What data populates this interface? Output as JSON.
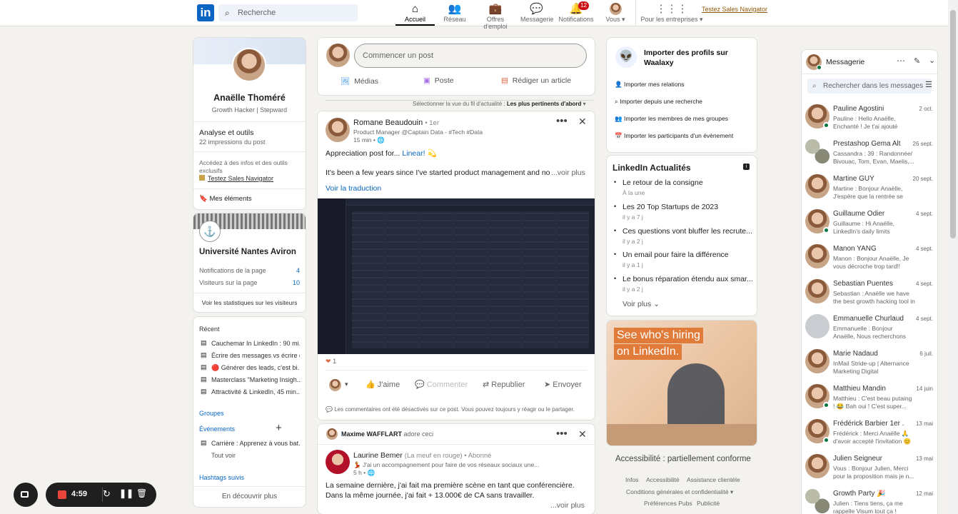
{
  "topbar": {
    "logo": "in",
    "search_placeholder": "Recherche",
    "nav": [
      {
        "label": "Accueil",
        "icon": "home-icon"
      },
      {
        "label": "Réseau",
        "icon": "network-icon"
      },
      {
        "label": "Offres d'emploi",
        "icon": "jobs-icon"
      },
      {
        "label": "Messagerie",
        "icon": "messaging-icon"
      },
      {
        "label": "Notifications",
        "icon": "bell-icon",
        "badge": "12"
      },
      {
        "label": "Vous ▾",
        "icon": "me-avatar"
      },
      {
        "label": "Pour les entreprises ▾",
        "icon": "grid-icon"
      }
    ],
    "sales_navigator": "Testez Sales Navigator"
  },
  "profile": {
    "name": "Anaëlle Thoméré",
    "headline": "Growth Hacker | Stepward",
    "analytics_title": "Analyse et outils",
    "analytics_sub": "22 impressions du post",
    "premium_text": "Accédez à des infos et des outils exclusifs",
    "premium_link": "Testez Sales Navigator",
    "saved": "Mes éléments"
  },
  "page_card": {
    "name": "Université Nantes Aviron",
    "notif_label": "Notifications de la page",
    "notif_value": "4",
    "visitors_label": "Visiteurs sur la page",
    "visitors_value": "10",
    "stats_link": "Voir les statistiques sur les visiteurs"
  },
  "recent": {
    "title": "Récent",
    "items": [
      "Cauchemar In LinkedIn : 90 mi...",
      "Écrire des messages vs écrire d...",
      "🔴 Générer des leads, c'est bi...",
      "Masterclass \"Marketing Insigh...",
      "Attractivité & LinkedIn, 45 min..."
    ],
    "groups": "Groupes",
    "events": "Événements",
    "event_item": "Carrière : Apprenez à vous bat...",
    "see_all": "Tout voir",
    "hashtags": "Hashtags suivis",
    "discover": "En découvrir plus"
  },
  "composer": {
    "placeholder": "Commencer un post",
    "media": "Médias",
    "post": "Poste",
    "article": "Rédiger un article"
  },
  "feed_sort": {
    "label": "Sélectionner la vue du fil d'actualité :",
    "value": "Les plus pertinents d'abord"
  },
  "post1": {
    "author": "Romane Beaudouin",
    "degree": "• 1er",
    "headline": "Product Manager @Captain Data - #Tech #Data",
    "time": "15 min • 🌐",
    "text1": "Appreciation post for...",
    "mention": "Linear!",
    "emoji": "💫",
    "text2": "It's been a few years since I've started product management and nobody",
    "see_more": "...voir plus",
    "translate": "Voir la traduction",
    "reactions": "1",
    "like": "J'aime",
    "comment": "Commenter",
    "repost": "Republier",
    "send": "Envoyer",
    "comments_off": "Les commentaires ont été désactivés sur ce post. Vous pouvez toujours y réagir ou le partager."
  },
  "post2": {
    "liker": "Maxime WAFFLART",
    "liker_action": "adore ceci",
    "author": "Laurine Bemer",
    "author_note": "(La meuf en rouge) • Abonné",
    "headline": "💃 J'ai un accompagnement pour faire de vos réseaux sociaux une...",
    "time": "5 h • 🌐",
    "line1": "La semaine dernière, j'ai fait ma première scène en tant que conférencière.",
    "line2": "Dans la même journée, j'ai fait + 13.000€ de CA sans travailler.",
    "see_more": "...voir plus"
  },
  "waalaxy": {
    "title": "Importer des profils sur Waalaxy",
    "items": [
      "Importer mes relations",
      "Importer depuis une recherche",
      "Importer les membres de mes groupes",
      "Importer les participants d'un évènement"
    ]
  },
  "news": {
    "title": "LinkedIn Actualités",
    "items": [
      {
        "title": "Le retour de la consigne",
        "sub": "À la une"
      },
      {
        "title": "Les 20 Top Startups de 2023",
        "sub": "il y a 7 j"
      },
      {
        "title": "Ces questions vont bluffer les recrute...",
        "sub": "il y a 2 j"
      },
      {
        "title": "Un email pour faire la différence",
        "sub": "il y a 1 j"
      },
      {
        "title": "Le bonus réparation étendu aux smar...",
        "sub": "il y a 2 j"
      }
    ],
    "more": "Voir plus"
  },
  "ad": {
    "text1": "See who's hiring",
    "text2": "on LinkedIn."
  },
  "footer": {
    "accessibility": "Accessibilité : partiellement conforme",
    "links1": [
      "Infos",
      "Accessibilité",
      "Assistance clientèle"
    ],
    "links2": "Conditions générales et confidentialité ▾",
    "links3": [
      "Préférences Pubs",
      "Publicité"
    ]
  },
  "messaging": {
    "title": "Messagerie",
    "search_placeholder": "Rechercher dans les messages",
    "threads": [
      {
        "name": "Pauline Agostini",
        "date": "2 oct.",
        "preview": "Pauline : Hello Anaëlle, Enchanté ! Je t'ai ajouté parce...",
        "online": true
      },
      {
        "name": "Prestashop Gema Alt",
        "date": "26 sept.",
        "preview": "Cassandra : 39 : Randonnée/ Bivouac, Tom, Evan, Maelis,...",
        "online": false
      },
      {
        "name": "Martine GUY",
        "date": "20 sept.",
        "preview": "Martine : Bonjour Anaëlle, J'espère que la rentrée se pas...",
        "online": false
      },
      {
        "name": "Guillaume Odier",
        "date": "4 sept.",
        "preview": "Guillaume : Hi Anaëlle, LinkedIn's daily limits slowing...",
        "online": true
      },
      {
        "name": "Manon YANG",
        "date": "4 sept.",
        "preview": "Manon : Bonjour Anaëlle, Je vous décroche trop tard!! Eta...",
        "online": false
      },
      {
        "name": "Sebastian Puentes",
        "date": "4 sept.",
        "preview": "Sebastian : Anaëlle we have the best growth hacking tool in t...",
        "online": false
      },
      {
        "name": "Emmanuelle Churlaud",
        "date": "4 sept.",
        "preview": "Emmanuelle : Bonjour Anaëlle, Nous recherchons un. Growth...",
        "online": false
      },
      {
        "name": "Marie Nadaud",
        "date": "6 juil.",
        "preview": "InMail  Stride-up | Alternance Marketing Digital",
        "online": false
      },
      {
        "name": "Matthieu Mandin",
        "date": "14 juin",
        "preview": "Matthieu : C'est beau putaing ! 😂 Bah oui ! C'est super...",
        "online": true
      },
      {
        "name": "Frédérick Barbier 1er ...",
        "date": "13 mai",
        "preview": "Frédérick : Merci Anaëlle 🙏 d'avoir accepté l'invitation 😊",
        "online": true
      },
      {
        "name": "Julien Seigneur",
        "date": "13 mai",
        "preview": "Vous : Bonjour Julien, Merci pour la proposition mais je n...",
        "online": false
      },
      {
        "name": "Growth Party 🎉",
        "date": "12 mai",
        "preview": "Julien : Tiens tiens, ça me rappelle Visum tout ça !",
        "online": false
      }
    ]
  },
  "recorder": {
    "time": "4:59"
  },
  "colors": {
    "brand": "#0a66c2",
    "background": "#f3f2ef",
    "badge": "#cc1016",
    "online": "#057642"
  }
}
